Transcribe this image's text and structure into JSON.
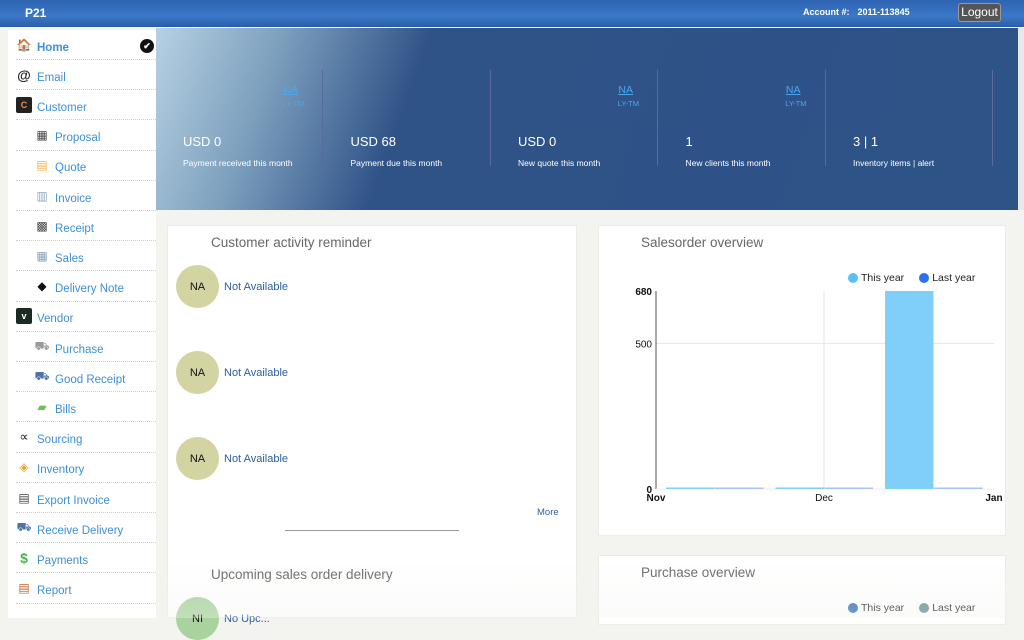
{
  "header": {
    "brand": "P21",
    "account_label": "Account #:",
    "account_number": "2011-113845",
    "logout_label": "Logout"
  },
  "sidebar": {
    "items": [
      {
        "label": "Home",
        "icon": "home-icon",
        "glyph": "🏠",
        "active": true,
        "sub": false
      },
      {
        "label": "Email",
        "icon": "at-icon",
        "glyph": "@",
        "sub": false
      },
      {
        "label": "Customer",
        "icon": "customer-icon",
        "glyph": "C",
        "sub": false
      },
      {
        "label": "Proposal",
        "icon": "proposal-icon",
        "glyph": "▦",
        "sub": true
      },
      {
        "label": "Quote",
        "icon": "quote-icon",
        "glyph": "▤",
        "sub": true
      },
      {
        "label": "Invoice",
        "icon": "invoice-icon",
        "glyph": "▥",
        "sub": true
      },
      {
        "label": "Receipt",
        "icon": "receipt-icon",
        "glyph": "▩",
        "sub": true
      },
      {
        "label": "Sales",
        "icon": "calculator-icon",
        "glyph": "▦",
        "sub": true
      },
      {
        "label": "Delivery Note",
        "icon": "box-icon",
        "glyph": "◆",
        "sub": true
      },
      {
        "label": "Vendor",
        "icon": "vendor-icon",
        "glyph": "v",
        "sub": false
      },
      {
        "label": "Purchase",
        "icon": "cart-icon",
        "glyph": "⛟",
        "sub": true
      },
      {
        "label": "Good Receipt",
        "icon": "truck-icon",
        "glyph": "⛟",
        "sub": true
      },
      {
        "label": "Bills",
        "icon": "money-icon",
        "glyph": "▰",
        "sub": true
      },
      {
        "label": "Sourcing",
        "icon": "share-icon",
        "glyph": "∝",
        "sub": false
      },
      {
        "label": "Inventory",
        "icon": "package-icon",
        "glyph": "◈",
        "sub": false
      },
      {
        "label": "Export Invoice",
        "icon": "export-invoice-icon",
        "glyph": "▤",
        "sub": false
      },
      {
        "label": "Receive Delivery",
        "icon": "truck-icon",
        "glyph": "⛟",
        "sub": false
      },
      {
        "label": "Payments",
        "icon": "dollar-icon",
        "glyph": "$",
        "sub": false
      },
      {
        "label": "Report",
        "icon": "report-icon",
        "glyph": "▤",
        "sub": false
      }
    ]
  },
  "stats": [
    {
      "value": "USD 0",
      "caption": "Payment received this month",
      "link": "NA",
      "sublabel": "LY-TM"
    },
    {
      "value": "USD 68",
      "caption": "Payment due this month",
      "link": "",
      "sublabel": ""
    },
    {
      "value": "USD 0",
      "caption": "New quote this month",
      "link": "NA",
      "sublabel": "LY-TM"
    },
    {
      "value": "1",
      "caption": "New clients this month",
      "link": "NA",
      "sublabel": "LY-TM"
    },
    {
      "value": "3 | 1",
      "caption": "Inventory items | alert",
      "link": "",
      "sublabel": ""
    }
  ],
  "reminder": {
    "title": "Customer activity reminder",
    "items": [
      {
        "initials": "NA",
        "text": "Not Available"
      },
      {
        "initials": "NA",
        "text": "Not Available"
      },
      {
        "initials": "NA",
        "text": "Not Available"
      }
    ],
    "more_label": "More"
  },
  "delivery": {
    "title": "Upcoming sales order delivery",
    "items": [
      {
        "initials": "NI",
        "text": "No Upc..."
      }
    ]
  },
  "salesorder": {
    "title": "Salesorder overview",
    "legend": [
      {
        "label": "This year",
        "color": "#5bc0f8"
      },
      {
        "label": "Last year",
        "color": "#2a6ff0"
      }
    ]
  },
  "purchase": {
    "title": "Purchase overview",
    "legend": [
      {
        "label": "This year",
        "color": "#2e6db5"
      },
      {
        "label": "Last year",
        "color": "#5f8c8e"
      }
    ]
  },
  "chart_data": {
    "type": "bar",
    "title": "Salesorder overview",
    "categories": [
      "Nov",
      "Dec",
      "Jan"
    ],
    "x_tick_labels": [
      "Nov",
      "Dec",
      "Jan"
    ],
    "y_tick_labels": [
      "0",
      "500",
      "680"
    ],
    "ylim": [
      0,
      680
    ],
    "grid": true,
    "legend_position": "top-right",
    "series": [
      {
        "name": "This year",
        "color": "#7fcffa",
        "values": [
          0,
          0,
          680
        ]
      },
      {
        "name": "Last year",
        "color": "#a9c4f0",
        "values": [
          0,
          0,
          0
        ]
      }
    ]
  }
}
